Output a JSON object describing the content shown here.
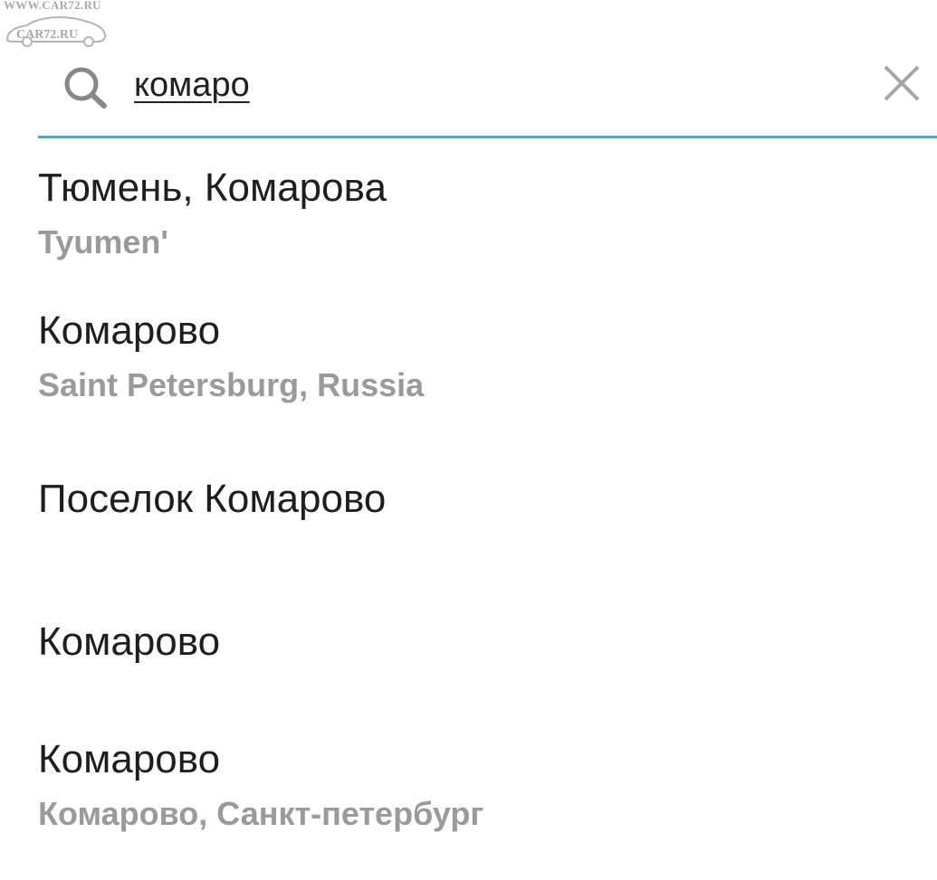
{
  "watermark": {
    "top_text": "WWW.CAR72.RU",
    "logo_text": "CAR72.RU"
  },
  "search": {
    "query": "комаро",
    "search_icon": "search-icon",
    "clear_icon": "close-icon",
    "accent_color": "#5aa3b6"
  },
  "results": [
    {
      "title": "Тюмень, Комарова",
      "subtitle": "Tyumen'"
    },
    {
      "title": "Комарово",
      "subtitle": "Saint Petersburg, Russia"
    },
    {
      "title": "Поселок Комарово",
      "subtitle": ""
    },
    {
      "title": "Комарово",
      "subtitle": ""
    },
    {
      "title": "Комарово",
      "subtitle": "Комарово, Санкт-петербург"
    }
  ]
}
